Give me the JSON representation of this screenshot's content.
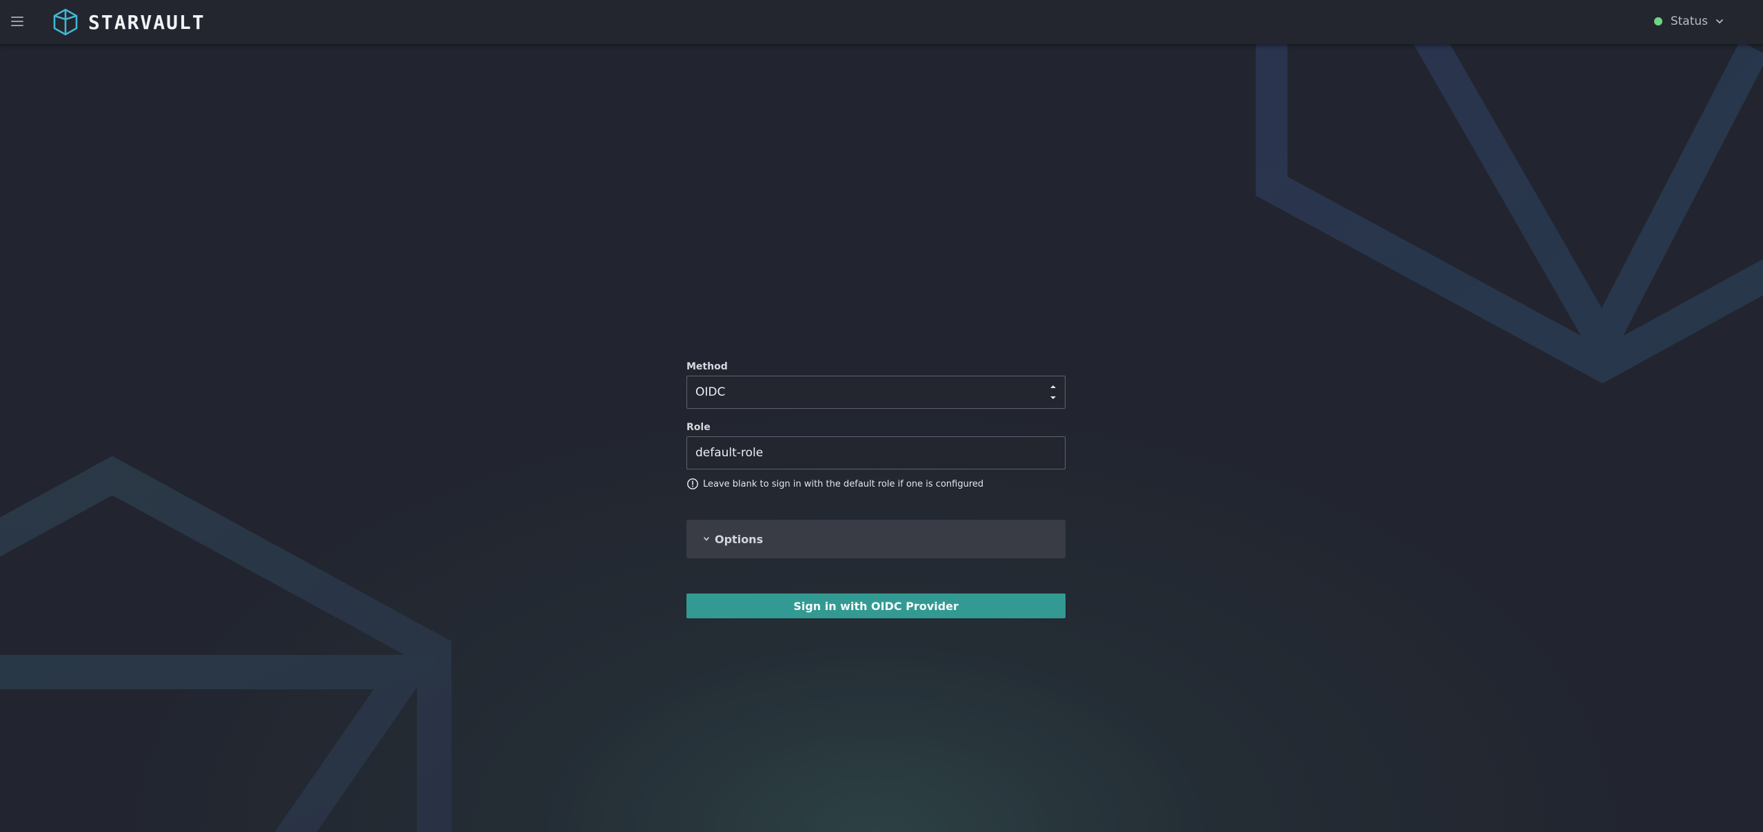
{
  "header": {
    "menu_icon": "hamburger-menu-icon",
    "logo_icon": "polyhedron-logo-icon",
    "brand_name": "STARVAULT",
    "status": {
      "label": "Status",
      "dot_color": "#6fd481",
      "icon": "chevron-down-icon"
    }
  },
  "login_form": {
    "method": {
      "label": "Method",
      "value": "OIDC",
      "icon": "sort-arrows-icon"
    },
    "role": {
      "label": "Role",
      "value": "default-role",
      "helper_icon": "info-circle-icon",
      "helper_text": "Leave blank to sign in with the default role if one is configured"
    },
    "options": {
      "label": "Options",
      "icon": "chevron-down-icon"
    },
    "submit_label": "Sign in with OIDC Provider"
  },
  "colors": {
    "background": "#22252f",
    "accent": "#339a93",
    "logo": "#3fb6d3",
    "background_shape_top_right": "#2d3650",
    "background_shape_bottom_left": "#2b3a4a"
  }
}
